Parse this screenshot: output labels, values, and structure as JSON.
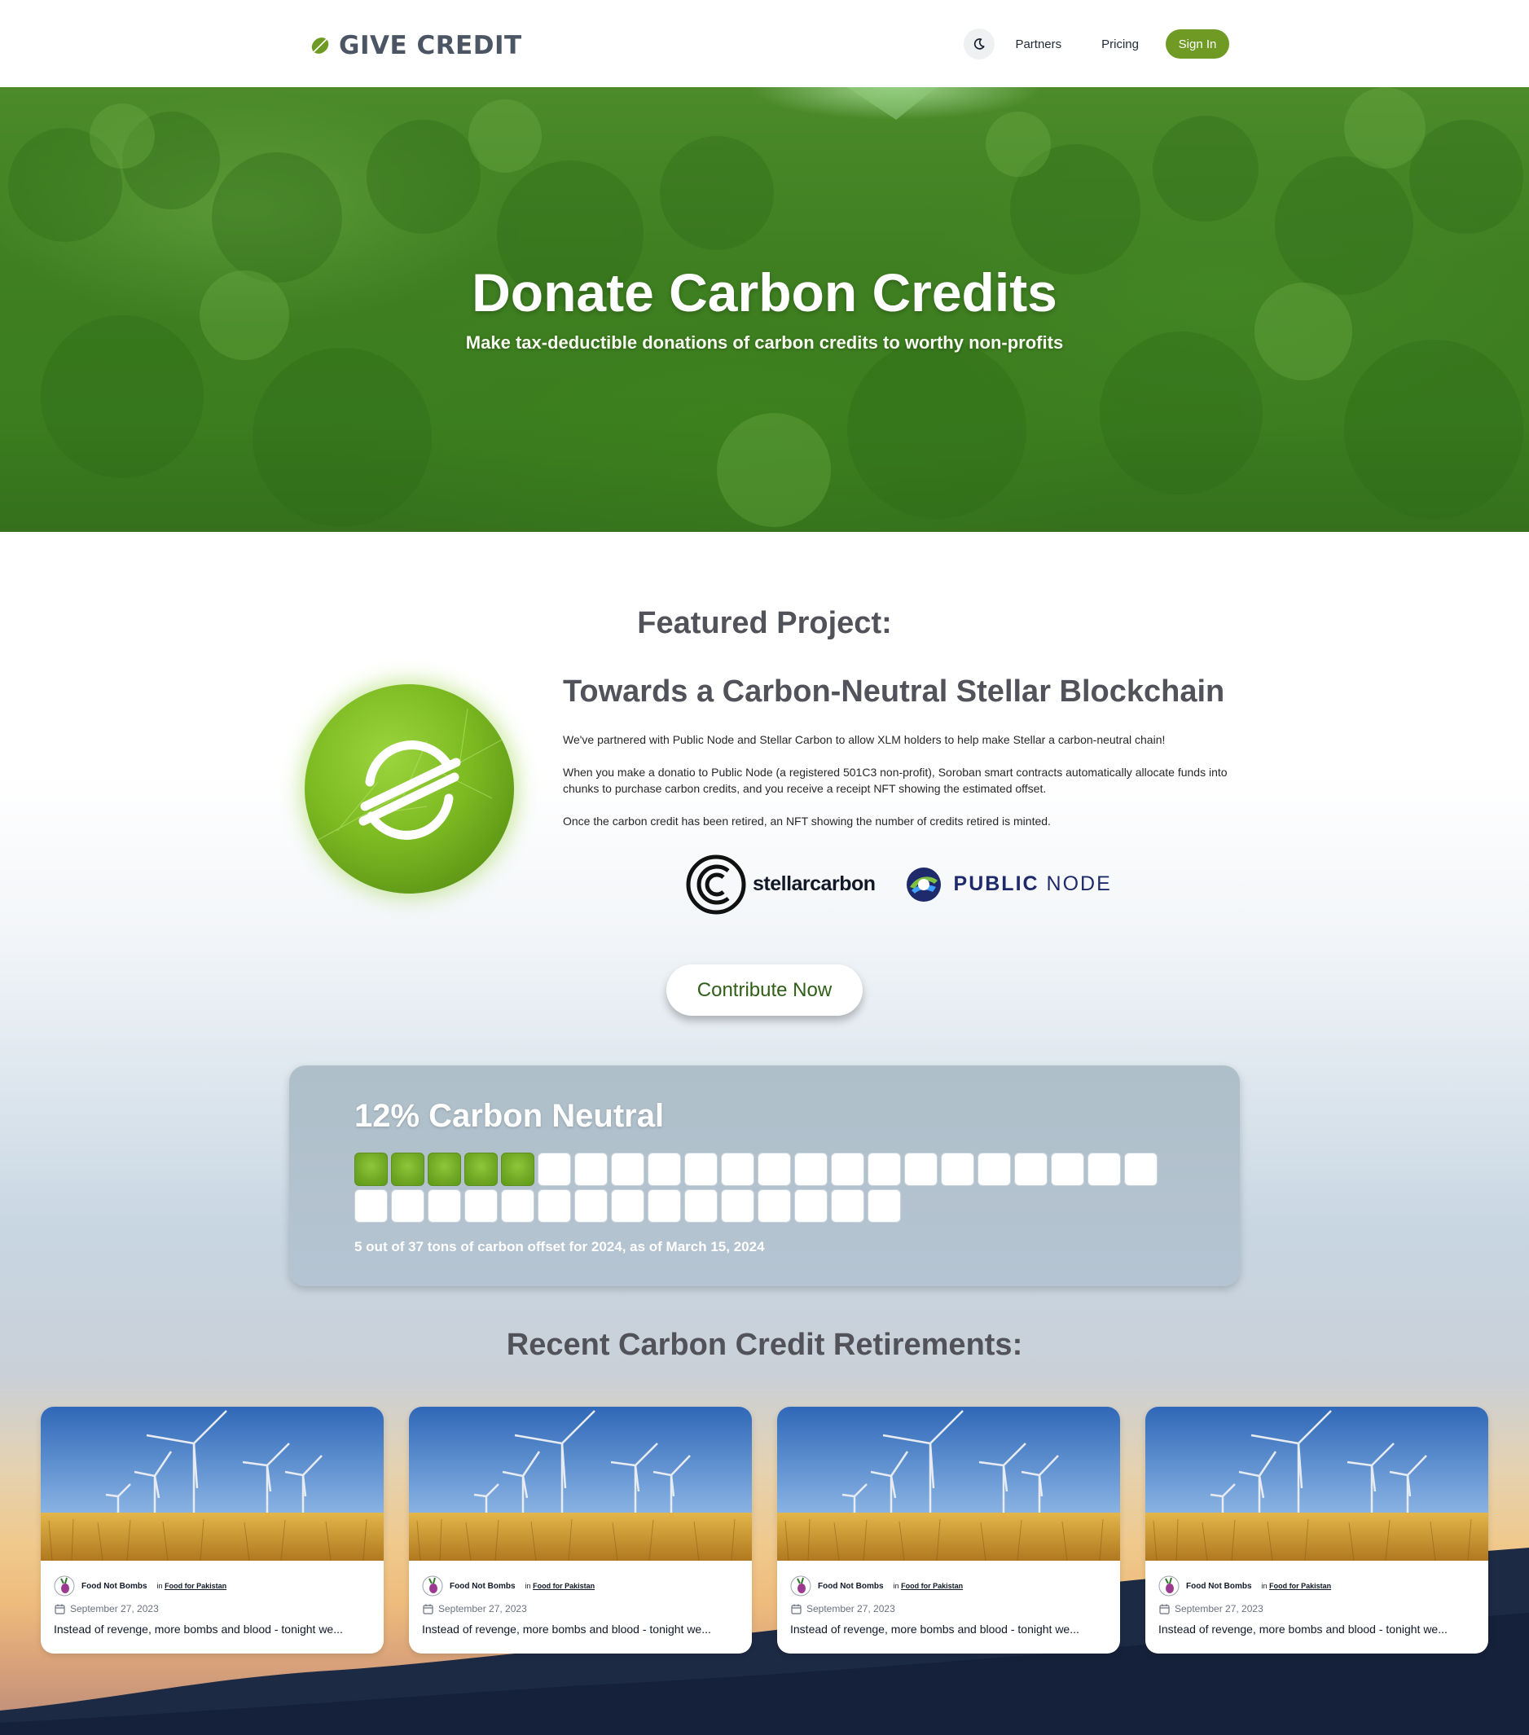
{
  "header": {
    "brand": "GIVE CREDIT",
    "nav": {
      "partners": "Partners",
      "pricing": "Pricing",
      "sign_in": "Sign In"
    }
  },
  "hero": {
    "title": "Donate Carbon Credits",
    "subtitle": "Make tax-deductible donations of carbon credits to worthy non-profits"
  },
  "featured": {
    "heading": "Featured Project:",
    "title": "Towards a Carbon-Neutral Stellar Blockchain",
    "paragraphs": [
      "We've partnered with Public Node and Stellar Carbon to allow XLM holders to help make Stellar a carbon-neutral chain!",
      "When you make a donatio to Public Node (a registered 501C3 non-profit), Soroban smart contracts automatically allocate funds into chunks to purchase carbon credits, and you receive a receipt NFT showing the estimated offset.",
      "Once the carbon credit has been retired, an NFT showing the number of credits retired is minted."
    ],
    "partners": {
      "stellarcarbon": "stellarcarbon",
      "publicnode_bold": "PUBLIC",
      "publicnode_light": "NODE"
    },
    "cta": "Contribute Now"
  },
  "neutral": {
    "title": "12% Carbon Neutral",
    "filled": 5,
    "total": 37,
    "caption": "5 out of 37 tons of carbon offset for 2024, as of March 15, 2024"
  },
  "retirements": {
    "heading": "Recent Carbon Credit Retirements:",
    "cards": [
      {
        "org": "Food Not Bombs",
        "in_prefix": "in",
        "project": "Food for Pakistan",
        "date": "September 27, 2023",
        "text": "Instead of revenge, more bombs and blood - tonight we..."
      },
      {
        "org": "Food Not Bombs",
        "in_prefix": "in",
        "project": "Food for Pakistan",
        "date": "September 27, 2023",
        "text": "Instead of revenge, more bombs and blood - tonight we..."
      },
      {
        "org": "Food Not Bombs",
        "in_prefix": "in",
        "project": "Food for Pakistan",
        "date": "September 27, 2023",
        "text": "Instead of revenge, more bombs and blood - tonight we..."
      },
      {
        "org": "Food Not Bombs",
        "in_prefix": "in",
        "project": "Food for Pakistan",
        "date": "September 27, 2023",
        "text": "Instead of revenge, more bombs and blood - tonight we..."
      }
    ]
  },
  "colors": {
    "accent": "#6f9a24",
    "heading": "#52525b"
  },
  "icons": [
    "leaf-icon",
    "moon-icon",
    "stellar-icon",
    "calendar-icon"
  ]
}
